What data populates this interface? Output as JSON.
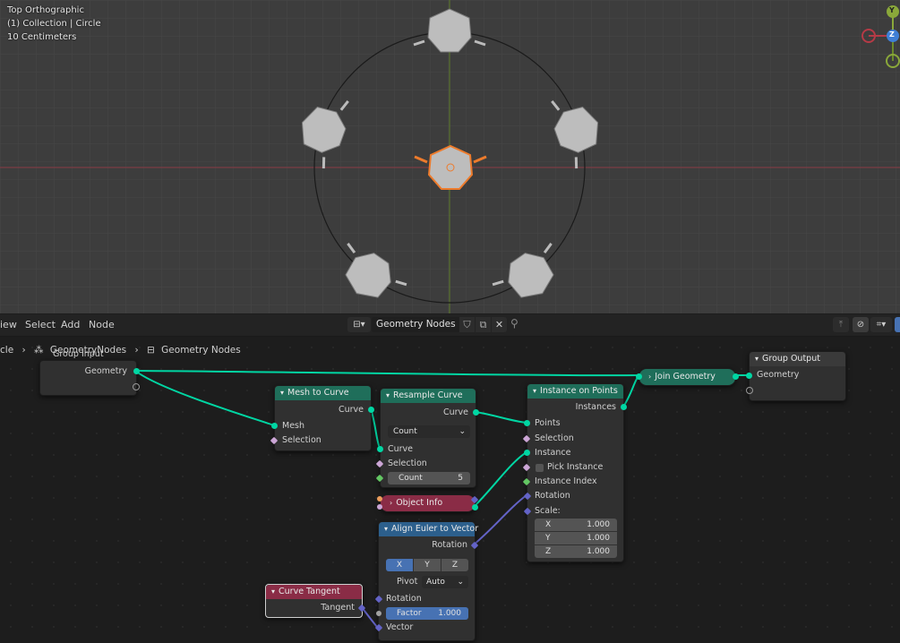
{
  "viewport": {
    "view_name": "Top Orthographic",
    "collection": "(1) Collection | Circle",
    "scale": "10 Centimeters",
    "gizmo": {
      "y": "Y",
      "z": "Z"
    }
  },
  "header": {
    "menus": [
      "iew",
      "Select",
      "Add",
      "Node"
    ],
    "tree_name": "Geometry Nodes"
  },
  "breadcrumb": {
    "object": "cle",
    "modifier": "GeometryNodes",
    "tree": "Geometry Nodes"
  },
  "nodes": {
    "group_input": {
      "title": "Group Input",
      "out_geometry": "Geometry"
    },
    "mesh_to_curve": {
      "title": "Mesh to Curve",
      "out_curve": "Curve",
      "in_mesh": "Mesh",
      "in_selection": "Selection"
    },
    "resample_curve": {
      "title": "Resample Curve",
      "out_curve": "Curve",
      "mode": "Count",
      "in_curve": "Curve",
      "in_selection": "Selection",
      "count_label": "Count",
      "count_value": "5"
    },
    "object_info": {
      "title": "Object Info"
    },
    "align_euler": {
      "title": "Align Euler to Vector",
      "out_rotation": "Rotation",
      "axis_x": "X",
      "axis_y": "Y",
      "axis_z": "Z",
      "pivot_label": "Pivot",
      "pivot_value": "Auto",
      "in_rotation": "Rotation",
      "factor_label": "Factor",
      "factor_value": "1.000",
      "in_vector": "Vector"
    },
    "curve_tangent": {
      "title": "Curve Tangent",
      "out_tangent": "Tangent"
    },
    "instance_on_points": {
      "title": "Instance on Points",
      "out_instances": "Instances",
      "in_points": "Points",
      "in_selection": "Selection",
      "in_instance": "Instance",
      "pick_instance": "Pick Instance",
      "instance_index": "Instance Index",
      "in_rotation": "Rotation",
      "scale_label": "Scale:",
      "x_label": "X",
      "x_value": "1.000",
      "y_label": "Y",
      "y_value": "1.000",
      "z_label": "Z",
      "z_value": "1.000"
    },
    "join_geometry": {
      "title": "Join Geometry"
    },
    "group_output": {
      "title": "Group Output",
      "in_geometry": "Geometry"
    }
  },
  "colors": {
    "geometry_socket": "#00d6a3",
    "vector_socket": "#6363c7",
    "selection_active": "#ed7b2c",
    "viewport_bg": "#3d3d3d"
  }
}
